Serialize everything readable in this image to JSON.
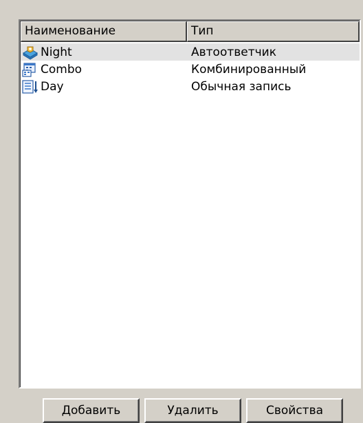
{
  "list": {
    "columns": {
      "name": "Наименование",
      "type": "Тип"
    },
    "rows": [
      {
        "name": "Night",
        "type": "Автоответчик",
        "icon": "answering-machine-icon",
        "selected": true
      },
      {
        "name": "Combo",
        "type": "Комбинированный",
        "icon": "combined-icon",
        "selected": false
      },
      {
        "name": "Day",
        "type": "Обычная запись",
        "icon": "regular-record-icon",
        "selected": false
      }
    ]
  },
  "buttons": {
    "add": "Добавить",
    "delete": "Удалить",
    "properties": "Свойства"
  },
  "colors": {
    "window_bg": "#d4d0c8",
    "list_bg": "#ffffff",
    "selected_row": "#e2e2e2"
  }
}
